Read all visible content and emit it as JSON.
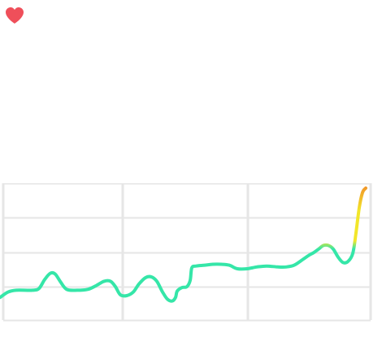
{
  "favorite": {
    "icon": "heart-icon",
    "color": "#ef4f5a"
  },
  "chart_data": {
    "type": "line",
    "grid": true,
    "colors": {
      "grid": "#e6e6e6",
      "line_low": "#35e6a8",
      "line_mid": "#f2e62a",
      "line_high": "#f08a2a"
    },
    "series": [
      {
        "values": [
          [
            0,
            0.18
          ],
          [
            10,
            0.24
          ],
          [
            20,
            0.26
          ],
          [
            40,
            0.26
          ],
          [
            48,
            0.28
          ],
          [
            55,
            0.38
          ],
          [
            62,
            0.45
          ],
          [
            68,
            0.44
          ],
          [
            74,
            0.36
          ],
          [
            82,
            0.27
          ],
          [
            95,
            0.26
          ],
          [
            108,
            0.27
          ],
          [
            118,
            0.31
          ],
          [
            128,
            0.36
          ],
          [
            136,
            0.36
          ],
          [
            142,
            0.3
          ],
          [
            148,
            0.21
          ],
          [
            156,
            0.2
          ],
          [
            164,
            0.24
          ],
          [
            171,
            0.33
          ],
          [
            179,
            0.4
          ],
          [
            186,
            0.41
          ],
          [
            193,
            0.36
          ],
          [
            200,
            0.24
          ],
          [
            206,
            0.16
          ],
          [
            212,
            0.14
          ],
          [
            216,
            0.18
          ],
          [
            218,
            0.25
          ],
          [
            224,
            0.29
          ],
          [
            230,
            0.3
          ],
          [
            234,
            0.37
          ],
          [
            236,
            0.51
          ],
          [
            241,
            0.53
          ],
          [
            252,
            0.54
          ],
          [
            262,
            0.55
          ],
          [
            272,
            0.55
          ],
          [
            282,
            0.54
          ],
          [
            292,
            0.5
          ],
          [
            304,
            0.5
          ],
          [
            316,
            0.52
          ],
          [
            328,
            0.53
          ],
          [
            342,
            0.52
          ],
          [
            352,
            0.52
          ],
          [
            362,
            0.54
          ],
          [
            372,
            0.6
          ],
          [
            380,
            0.65
          ],
          [
            386,
            0.68
          ],
          [
            392,
            0.72
          ],
          [
            398,
            0.76
          ],
          [
            404,
            0.76
          ],
          [
            410,
            0.72
          ],
          [
            416,
            0.63
          ],
          [
            422,
            0.57
          ],
          [
            428,
            0.58
          ],
          [
            434,
            0.67
          ],
          [
            438,
            0.9
          ],
          [
            442,
            1.18
          ],
          [
            446,
            1.35
          ],
          [
            450,
            1.4
          ]
        ]
      }
    ]
  }
}
